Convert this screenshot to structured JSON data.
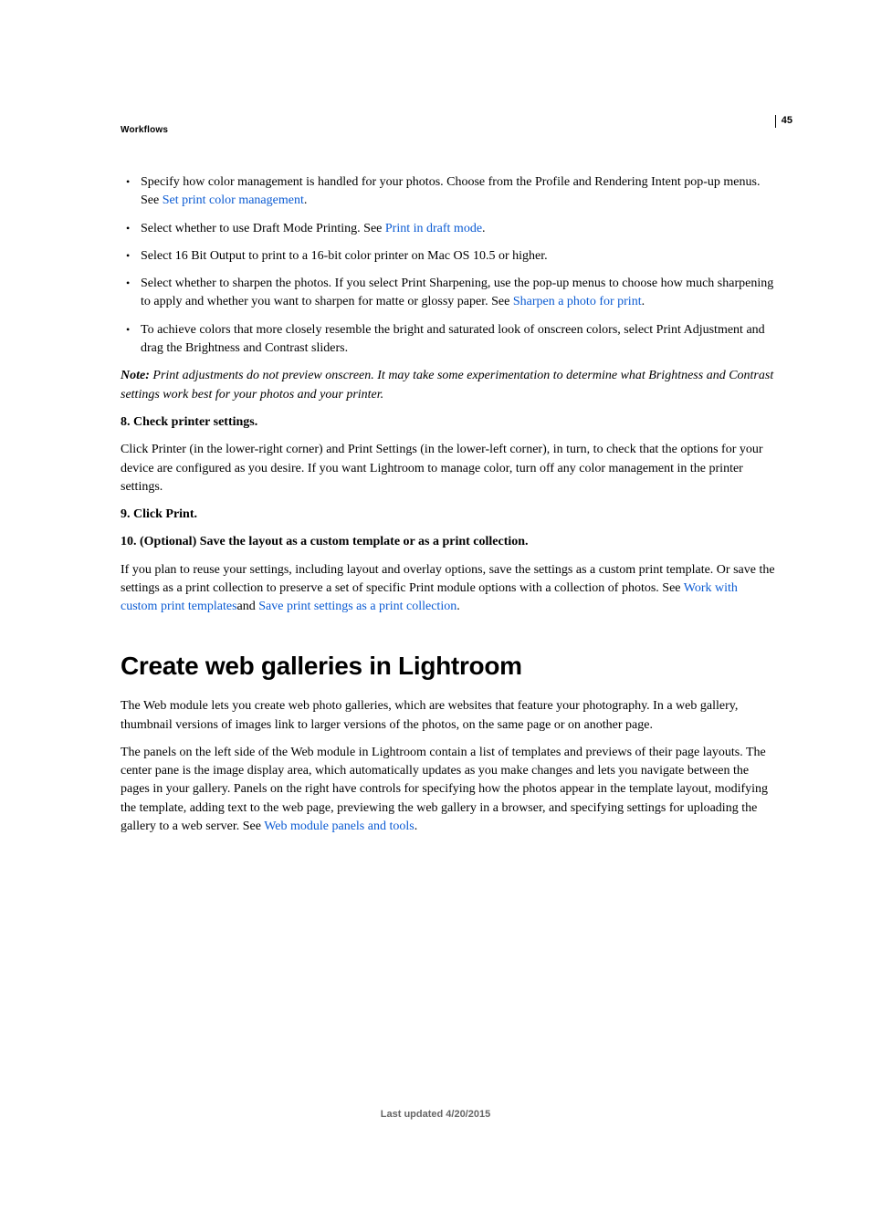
{
  "running_head": "Workflows",
  "page_number": "45",
  "bullets": [
    {
      "pre": "Specify how color management is handled for your photos. Choose from the Profile and Rendering Intent pop-up menus. See ",
      "link": "Set print color management",
      "post": "."
    },
    {
      "pre": "Select whether to use Draft Mode Printing. See ",
      "link": "Print in draft mode",
      "post": "."
    },
    {
      "pre": "Select 16 Bit Output to print to a 16-bit color printer on Mac OS 10.5 or higher.",
      "link": "",
      "post": ""
    },
    {
      "pre": "Select whether to sharpen the photos. If you select Print Sharpening, use the pop-up menus to choose how much sharpening to apply and whether you want to sharpen for matte or glossy paper. See ",
      "link": "Sharpen a photo for print",
      "post": "."
    },
    {
      "pre": "To achieve colors that more closely resemble the bright and saturated look of onscreen colors, select Print Adjustment and drag the Brightness and Contrast sliders.",
      "link": "",
      "post": ""
    }
  ],
  "note_label": "Note:",
  "note_body": " Print adjustments do not preview onscreen. It may take some experimentation to determine what Brightness and Contrast settings work best for your photos and your printer.",
  "step8_heading": "8. Check printer settings.",
  "step8_body": "Click Printer (in the lower-right corner) and Print Settings (in the lower-left corner), in turn, to check that the options for your device are configured as you desire. If you want Lightroom to manage color, turn off any color management in the printer settings.",
  "step9_heading": "9. Click Print.",
  "step10_heading": "10. (Optional) Save the layout as a custom template or as a print collection.",
  "step10_body_pre": "If you plan to reuse your settings, including layout and overlay options, save the settings as a custom print template. Or save the settings as a print collection to preserve a set of specific Print module options with a collection of photos. See ",
  "step10_link1": "Work with custom print templates",
  "step10_mid": "and ",
  "step10_link2": "Save print settings as a print collection",
  "step10_post": ".",
  "section_title": "Create web galleries in Lightroom",
  "web_p1": "The Web module lets you create web photo galleries, which are websites that feature your photography. In a web gallery, thumbnail versions of images link to larger versions of the photos, on the same page or on another page.",
  "web_p2_pre": "The panels on the left side of the Web module in Lightroom contain a list of templates and previews of their page layouts. The center pane is the image display area, which automatically updates as you make changes and lets you navigate between the pages in your gallery. Panels on the right have controls for specifying how the photos appear in the template layout, modifying the template, adding text to the web page, previewing the web gallery in a browser, and specifying settings for uploading the gallery to a web server. See ",
  "web_p2_link": "Web module panels and tools",
  "web_p2_post": ".",
  "footer": "Last updated 4/20/2015"
}
